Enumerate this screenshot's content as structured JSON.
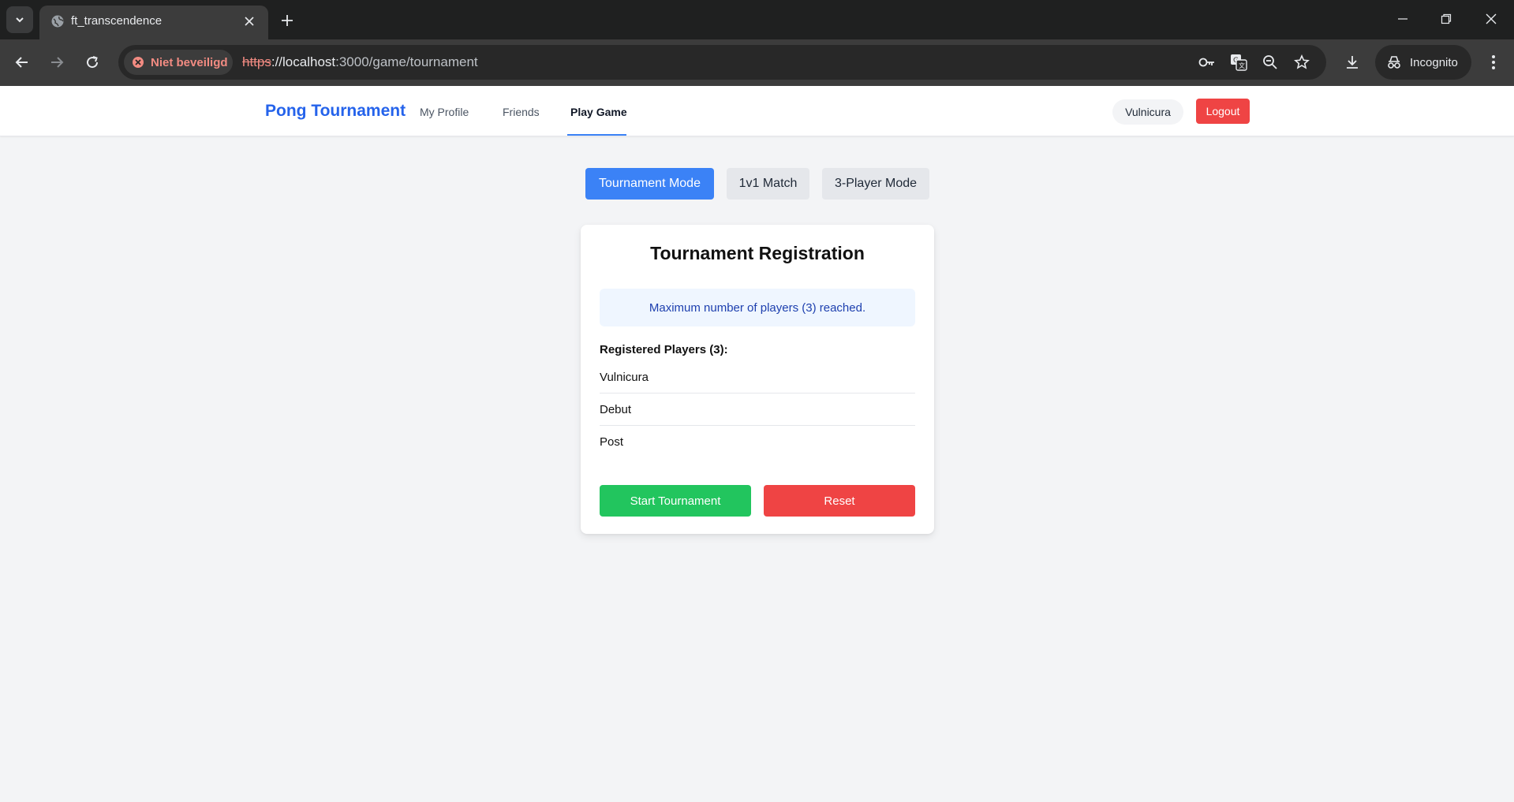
{
  "browser": {
    "tab_title": "ft_transcendence",
    "security_label": "Niet beveiligd",
    "url_scheme": "https",
    "url_host": "://localhost",
    "url_path": ":3000/game/tournament",
    "incognito_label": "Incognito"
  },
  "navbar": {
    "brand": "Pong Tournament",
    "links": [
      "My Profile",
      "Friends",
      "Play Game"
    ],
    "active_link": "Play Game",
    "username": "Vulnicura",
    "logout_label": "Logout"
  },
  "modes": {
    "items": [
      "Tournament Mode",
      "1v1 Match",
      "3-Player Mode"
    ],
    "active": "Tournament Mode"
  },
  "registration": {
    "title": "Tournament Registration",
    "notice": "Maximum number of players (3) reached.",
    "players_heading": "Registered Players (3):",
    "players": [
      "Vulnicura",
      "Debut",
      "Post"
    ],
    "start_label": "Start Tournament",
    "reset_label": "Reset"
  },
  "colors": {
    "brand": "#2563eb",
    "primary": "#3b82f6",
    "success": "#22c55e",
    "danger": "#ef4444"
  }
}
